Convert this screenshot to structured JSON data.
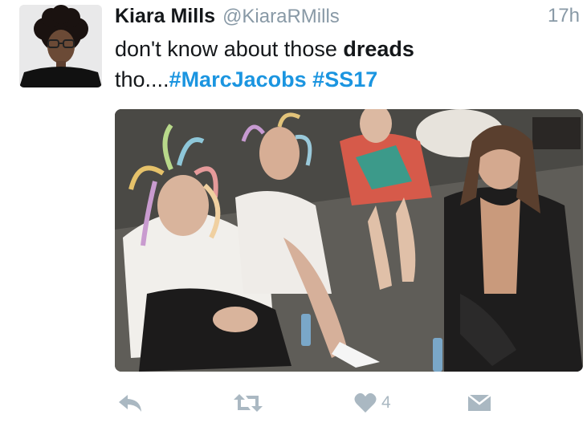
{
  "tweet": {
    "author_name": "Kiara Mills",
    "author_handle": "@KiaraRMills",
    "timestamp": "17h",
    "text_part1": "don't know about those ",
    "text_bold": "dreads",
    "text_part2": " tho....",
    "hashtag1": "#MarcJacobs",
    "hashtag2": "#SS17"
  },
  "actions": {
    "like_count": "4"
  },
  "icons": [
    "reply-icon",
    "retweet-icon",
    "like-icon",
    "direct-message-icon"
  ],
  "colors": {
    "link": "#1b95e0",
    "secondary_text": "#8899a6",
    "action_icon": "#aab8c2"
  }
}
